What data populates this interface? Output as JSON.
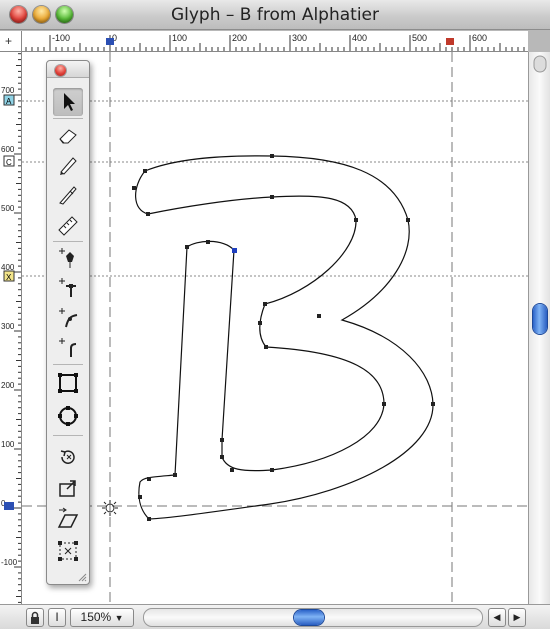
{
  "window": {
    "title": "Glyph – B from Alphatier"
  },
  "rulers": {
    "horizontal_ticks": [
      "-100",
      "0",
      "100",
      "200",
      "300",
      "400",
      "500",
      "600"
    ],
    "vertical_ticks": [
      "700",
      "600",
      "500",
      "400",
      "300",
      "200",
      "100",
      "0",
      "-100"
    ],
    "vertical_markers": [
      "A",
      "C",
      "X"
    ]
  },
  "toolbar": {
    "tools": [
      {
        "name": "pointer-tool",
        "selected": true
      },
      {
        "name": "eraser-tool"
      },
      {
        "name": "pen-draw-tool"
      },
      {
        "name": "knife-tool"
      },
      {
        "name": "measure-tool"
      },
      {
        "name": "add-point-tool"
      },
      {
        "name": "add-tangent-point-tool"
      },
      {
        "name": "add-curve-point-tool"
      },
      {
        "name": "add-corner-point-tool"
      },
      {
        "name": "rectangle-tool"
      },
      {
        "name": "ellipse-tool"
      },
      {
        "name": "rotate-tool"
      },
      {
        "name": "scale-tool"
      },
      {
        "name": "skew-tool"
      },
      {
        "name": "transform-tool"
      }
    ]
  },
  "statusbar": {
    "lock_label": "🔒",
    "info_label": "I",
    "zoom_value": "150%"
  },
  "colors": {
    "selected_point": "#1f3fbf",
    "guide_line": "#777777",
    "outline": "#111111",
    "scroll_thumb": "#3a78e0"
  }
}
